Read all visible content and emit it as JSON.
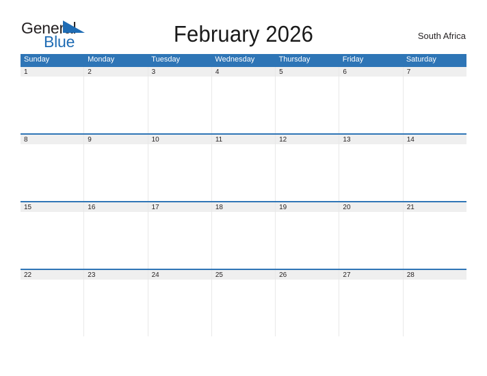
{
  "brand": {
    "name_part1": "General",
    "name_part2": "Blue",
    "color_dark": "#231f20",
    "color_blue": "#1f6cb4"
  },
  "header": {
    "title": "February 2026",
    "region": "South Africa"
  },
  "calendar": {
    "accent_color": "#2e75b6",
    "band_color": "#efefef",
    "month": "February",
    "year": "2026",
    "weekdays": [
      "Sunday",
      "Monday",
      "Tuesday",
      "Wednesday",
      "Thursday",
      "Friday",
      "Saturday"
    ],
    "weeks": [
      {
        "days": [
          {
            "number": "1"
          },
          {
            "number": "2"
          },
          {
            "number": "3"
          },
          {
            "number": "4"
          },
          {
            "number": "5"
          },
          {
            "number": "6"
          },
          {
            "number": "7"
          }
        ]
      },
      {
        "days": [
          {
            "number": "8"
          },
          {
            "number": "9"
          },
          {
            "number": "10"
          },
          {
            "number": "11"
          },
          {
            "number": "12"
          },
          {
            "number": "13"
          },
          {
            "number": "14"
          }
        ]
      },
      {
        "days": [
          {
            "number": "15"
          },
          {
            "number": "16"
          },
          {
            "number": "17"
          },
          {
            "number": "18"
          },
          {
            "number": "19"
          },
          {
            "number": "20"
          },
          {
            "number": "21"
          }
        ]
      },
      {
        "days": [
          {
            "number": "22"
          },
          {
            "number": "23"
          },
          {
            "number": "24"
          },
          {
            "number": "25"
          },
          {
            "number": "26"
          },
          {
            "number": "27"
          },
          {
            "number": "28"
          }
        ]
      }
    ]
  }
}
